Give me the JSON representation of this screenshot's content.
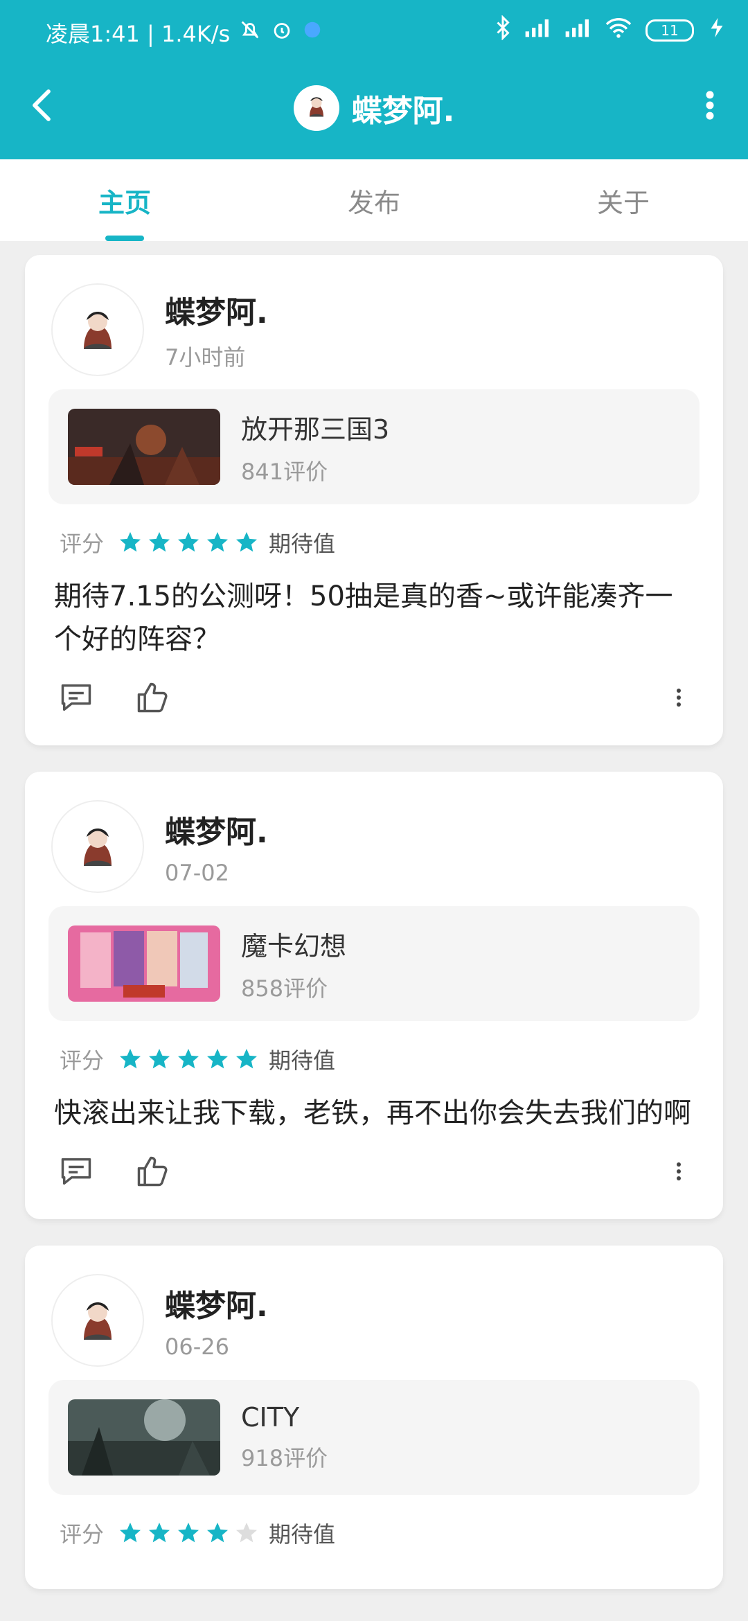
{
  "status_bar": {
    "time_speed": "凌晨1:41 | 1.4K/s",
    "battery": "11"
  },
  "appbar": {
    "title": "蝶梦阿."
  },
  "tabs": [
    {
      "label": "主页",
      "active": true
    },
    {
      "label": "发布",
      "active": false
    },
    {
      "label": "关于",
      "active": false
    }
  ],
  "posts": [
    {
      "user": "蝶梦阿.",
      "time": "7小时前",
      "game": {
        "name": "放开那三国3",
        "count": "841评价",
        "thumb_color": "#3a2a28"
      },
      "rating_label": "评分",
      "stars": 5,
      "expect_label": "期待值",
      "text": "期待7.15的公测呀！50抽是真的香~或许能凑齐一个好的阵容？"
    },
    {
      "user": "蝶梦阿.",
      "time": "07-02",
      "game": {
        "name": "魔卡幻想",
        "count": "858评价",
        "thumb_color": "#e66aa0"
      },
      "rating_label": "评分",
      "stars": 5,
      "expect_label": "期待值",
      "text": "快滚出来让我下载，老铁，再不出你会失去我们的啊"
    },
    {
      "user": "蝶梦阿.",
      "time": "06-26",
      "game": {
        "name": "CITY",
        "count": "918评价",
        "thumb_color": "#4b5a58"
      },
      "rating_label": "评分",
      "stars": 4,
      "expect_label": "期待值",
      "text": ""
    }
  ],
  "colors": {
    "accent": "#17b5c6",
    "star_on": "#17b5c6",
    "star_off": "#dddddd"
  }
}
